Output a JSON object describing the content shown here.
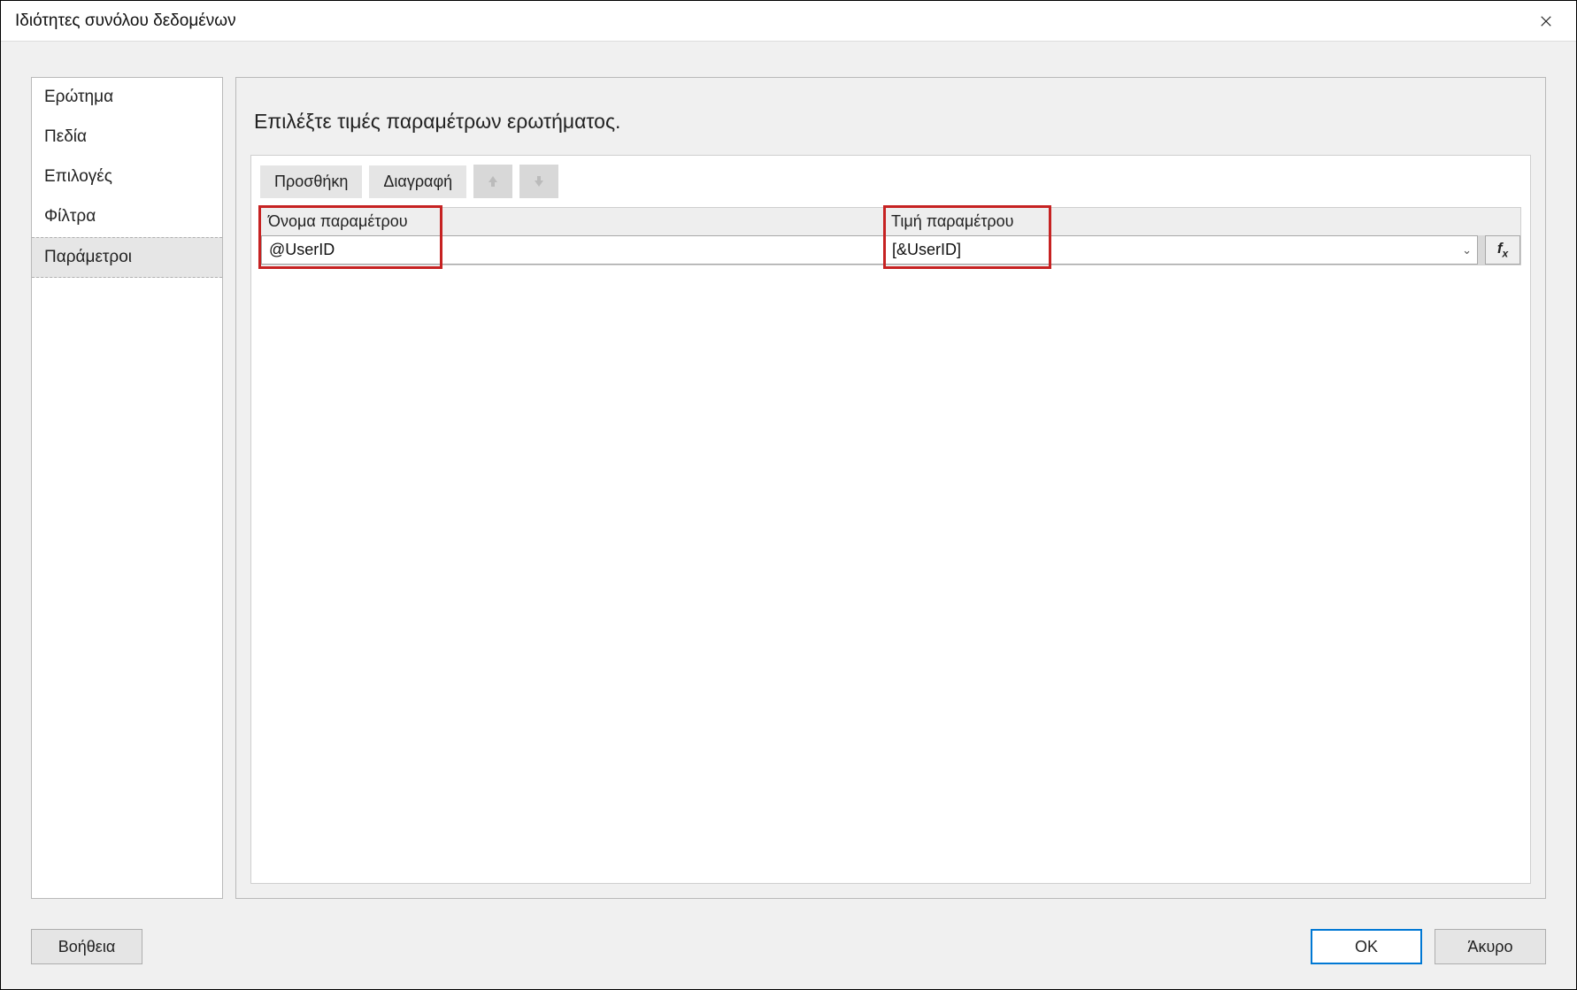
{
  "titlebar": {
    "title": "Ιδιότητες συνόλου δεδομένων"
  },
  "nav": {
    "items": [
      {
        "label": "Ερώτημα"
      },
      {
        "label": "Πεδία"
      },
      {
        "label": "Επιλογές"
      },
      {
        "label": "Φίλτρα"
      },
      {
        "label": "Παράμετροι"
      }
    ]
  },
  "content": {
    "heading": "Επιλέξτε τιμές παραμέτρων ερωτήματος."
  },
  "toolbar": {
    "add_label": "Προσθήκη",
    "delete_label": "Διαγραφή"
  },
  "grid": {
    "headers": {
      "name": "Όνομα παραμέτρου",
      "value": "Τιμή παραμέτρου"
    },
    "rows": [
      {
        "name": "@UserID",
        "value": "[&UserID]"
      }
    ]
  },
  "fx": {
    "label": "fx"
  },
  "footer": {
    "help": "Βοήθεια",
    "ok": "OK",
    "cancel": "Άκυρο"
  }
}
